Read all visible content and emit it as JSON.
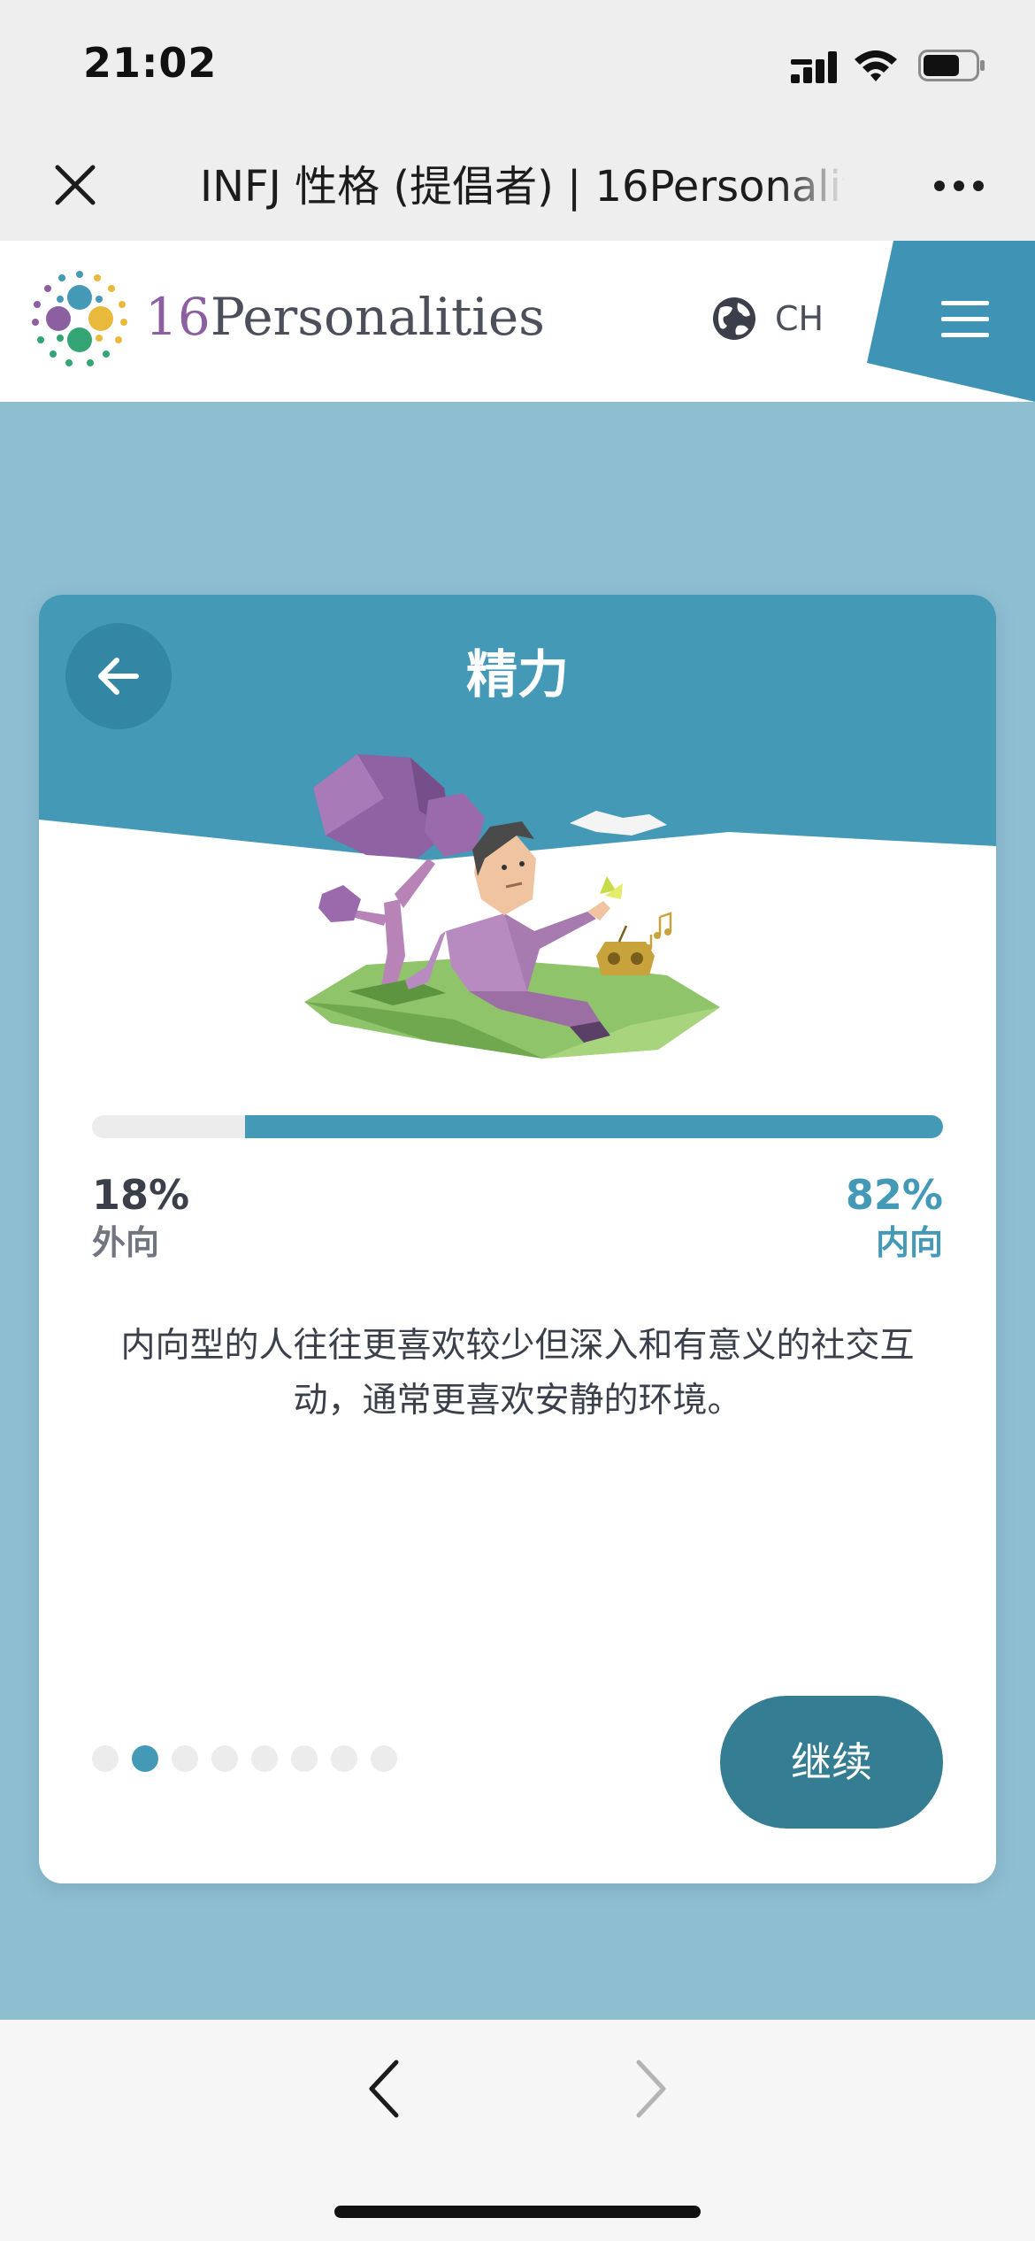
{
  "status_bar": {
    "time": "21:02",
    "icons": [
      "signal-icon",
      "wifi-icon",
      "battery-icon"
    ]
  },
  "browser": {
    "tab_title": "INFJ 性格 (提倡者) | 16Personalities",
    "close_icon": "close-icon",
    "more_icon": "more-icon"
  },
  "site_header": {
    "logo_number": "16",
    "logo_word": "Personalities",
    "language": "CH",
    "globe_icon": "globe-icon",
    "menu_icon": "menu-icon",
    "colors": {
      "accent": "#4499b7",
      "menu_tab": "#3f94b5"
    }
  },
  "card": {
    "title": "精力",
    "back_icon": "arrow-left-icon",
    "illustration": "introvert-illustration",
    "left_percent": "18%",
    "left_label": "外向",
    "right_percent": "82%",
    "right_label": "内向",
    "right_fraction": 0.82,
    "description": "内向型的人往往更喜欢较少但深入和有意义的社交互动，通常更喜欢安静的环境。",
    "pager": {
      "total": 8,
      "active_index": 1
    },
    "continue_label": "继续",
    "colors": {
      "header": "#4499b7",
      "bar_fill": "#4499b7",
      "bar_track": "#ececec",
      "button": "#357d92"
    }
  },
  "bottom_bar": {
    "back_icon": "chevron-left-icon",
    "forward_icon": "chevron-right-icon"
  }
}
